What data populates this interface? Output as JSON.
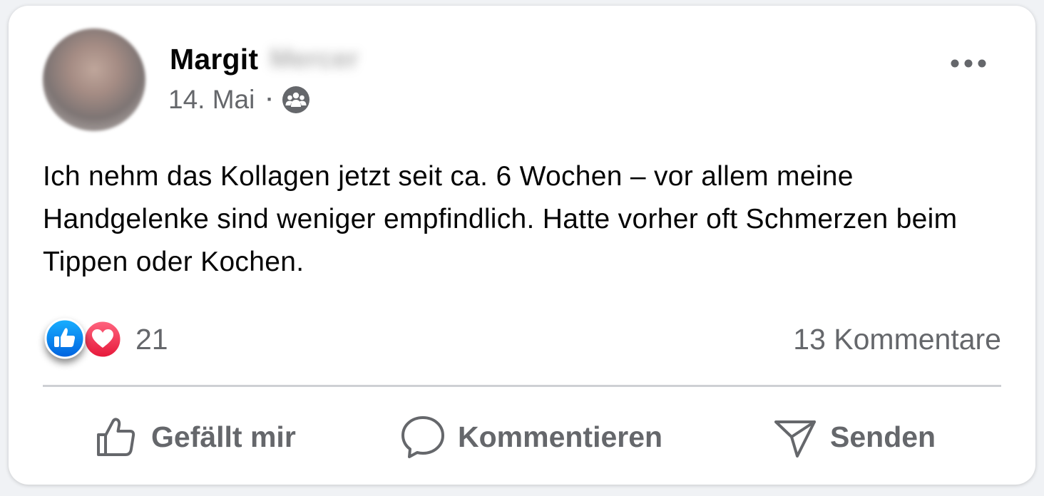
{
  "post": {
    "author_first_name": "Margit",
    "author_last_name_redacted": "Mercer",
    "date": "14. Mai",
    "separator": "·",
    "audience_icon": "group-icon",
    "text": "Ich nehm das Kollagen jetzt seit ca. 6 Wochen – vor allem meine Handgelenke sind weniger empfindlich. Hatte vorher oft Schmerzen beim Tippen oder Kochen.",
    "reactions": {
      "types": [
        "like",
        "love"
      ],
      "count": "21"
    },
    "comments_label": "13 Kommentare"
  },
  "actions": {
    "like_label": "Gefällt mir",
    "comment_label": "Kommentieren",
    "share_label": "Senden"
  },
  "colors": {
    "like_blue": "#1877f2",
    "love_red": "#f33e58",
    "secondary_text": "#65676b",
    "primary_text": "#050505"
  }
}
